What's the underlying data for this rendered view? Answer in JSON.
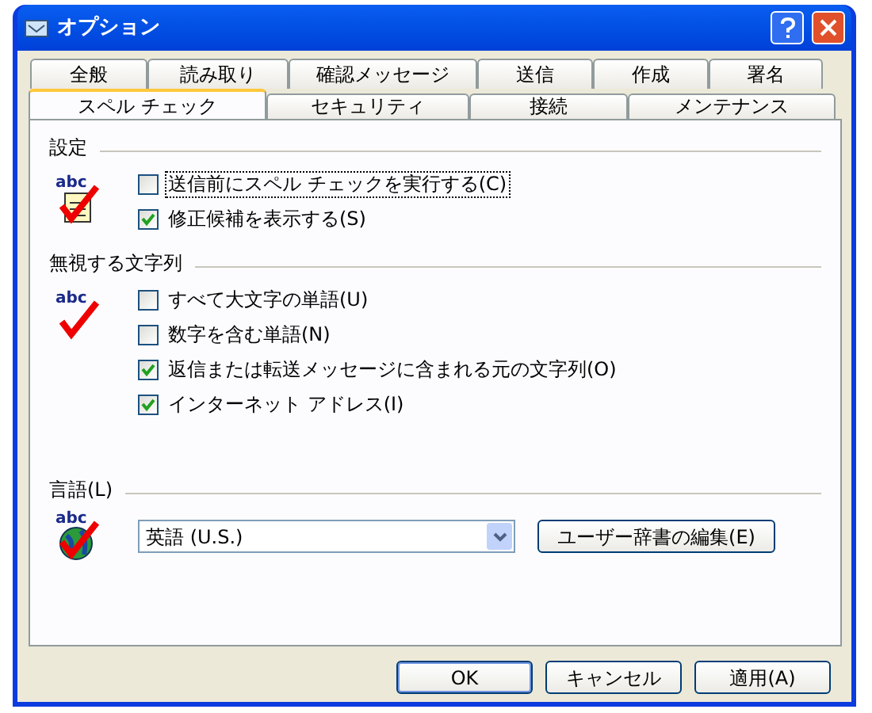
{
  "window": {
    "title": "オプション"
  },
  "tab_rows": [
    [
      {
        "label": "全般",
        "selected": false
      },
      {
        "label": "読み取り",
        "selected": false
      },
      {
        "label": "確認メッセージ",
        "selected": false
      },
      {
        "label": "送信",
        "selected": false
      },
      {
        "label": "作成",
        "selected": false
      },
      {
        "label": "署名",
        "selected": false
      }
    ],
    [
      {
        "label": "スペル チェック",
        "selected": true
      },
      {
        "label": "セキュリティ",
        "selected": false
      },
      {
        "label": "接続",
        "selected": false
      },
      {
        "label": "メンテナンス",
        "selected": false
      }
    ]
  ],
  "sections": [
    {
      "title": "設定",
      "icon_text": "abc",
      "options": [
        {
          "label": "送信前にスペル チェックを実行する(C)",
          "checked": false,
          "focused": true
        },
        {
          "label": "修正候補を表示する(S)",
          "checked": true,
          "focused": false
        }
      ]
    },
    {
      "title": "無視する文字列",
      "icon_text": "abc",
      "options": [
        {
          "label": "すべて大文字の単語(U)",
          "checked": false,
          "focused": false
        },
        {
          "label": "数字を含む単語(N)",
          "checked": false,
          "focused": false
        },
        {
          "label": "返信または転送メッセージに含まれる元の文字列(O)",
          "checked": true,
          "focused": false
        },
        {
          "label": "インターネット アドレス(I)",
          "checked": true,
          "focused": false
        }
      ]
    }
  ],
  "language": {
    "title": "言語(L)",
    "icon_text": "abc",
    "value": "英語 (U.S.)",
    "button": "ユーザー辞書の編集(E)"
  },
  "buttons": [
    "OK",
    "キャンセル",
    "適用(A)"
  ]
}
